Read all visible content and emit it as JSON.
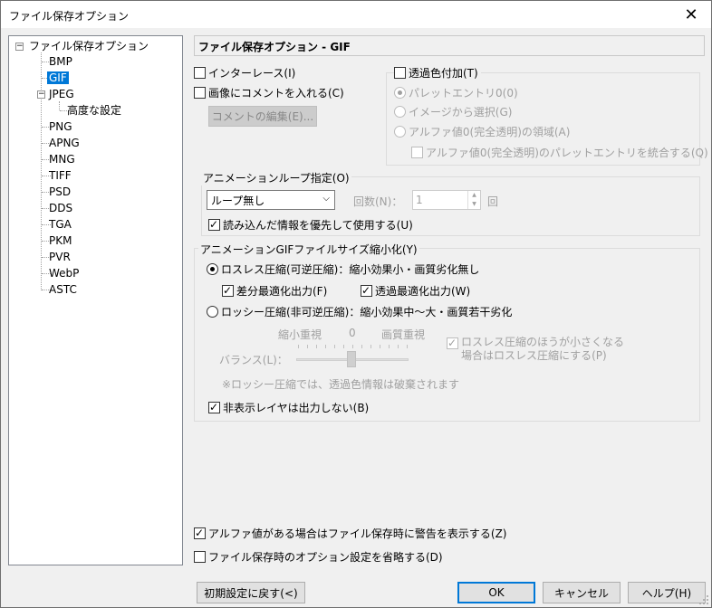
{
  "window": {
    "title": "ファイル保存オプション"
  },
  "tree": {
    "root": "ファイル保存オプション",
    "items": [
      {
        "label": "BMP"
      },
      {
        "label": "GIF"
      },
      {
        "label": "JPEG"
      },
      {
        "label": "高度な設定"
      },
      {
        "label": "PNG"
      },
      {
        "label": "APNG"
      },
      {
        "label": "MNG"
      },
      {
        "label": "TIFF"
      },
      {
        "label": "PSD"
      },
      {
        "label": "DDS"
      },
      {
        "label": "TGA"
      },
      {
        "label": "PKM"
      },
      {
        "label": "PVR"
      },
      {
        "label": "WebP"
      },
      {
        "label": "ASTC"
      }
    ],
    "root_expander": "⊟",
    "jpeg_expander": "⊟"
  },
  "panel": {
    "header": "ファイル保存オプション - GIF",
    "interlace": "インターレース(I)",
    "comment": "画像にコメントを入れる(C)",
    "edit_comment": "コメントの編集(E)...",
    "transparent": "透過色付加(T)",
    "palette_entry": "パレットエントリ0(0)",
    "from_image": "イメージから選択(G)",
    "alpha_area": "アルファ値0(完全透明)の領域(A)",
    "merge_alpha": "アルファ値0(完全透明)のパレットエントリを統合する(Q)",
    "anim_loop": {
      "title": "アニメーションループ指定(O)",
      "select_value": "ループ無し",
      "count_label": "回数(N)：",
      "count_value": "1",
      "count_unit": "回",
      "prefer_loaded": "読み込んだ情報を優先して使用する(U)"
    },
    "size_reduce": {
      "title": "アニメーションGIFファイルサイズ縮小化(Y)",
      "lossless": "ロスレス圧縮(可逆圧縮)：縮小効果小・画質劣化無し",
      "diff_opt": "差分最適化出力(F)",
      "trans_opt": "透過最適化出力(W)",
      "lossy": "ロッシー圧縮(非可逆圧縮)：縮小効果中～大・画質若干劣化",
      "slider_left": "縮小重視",
      "slider_mid": "0",
      "slider_right": "画質重視",
      "balance": "バランス(L)：",
      "smaller_line1": "ロスレス圧縮のほうが小さくなる",
      "smaller_line2": "場合はロスレス圧縮にする(P)",
      "lossy_note": "※ロッシー圧縮では、透過色情報は破棄されます",
      "hidden_layers": "非表示レイヤは出力しない(B)"
    },
    "alpha_warning": "アルファ値がある場合はファイル保存時に警告を表示する(Z)",
    "skip_options": "ファイル保存時のオプション設定を省略する(D)"
  },
  "buttons": {
    "reset": "初期設定に戻す(<)",
    "ok": "OK",
    "cancel": "キャンセル",
    "help": "ヘルプ(H)"
  },
  "icons": {
    "close": "✕",
    "dropdown": "⌵",
    "spin_up": "▲",
    "spin_down": "▼"
  }
}
